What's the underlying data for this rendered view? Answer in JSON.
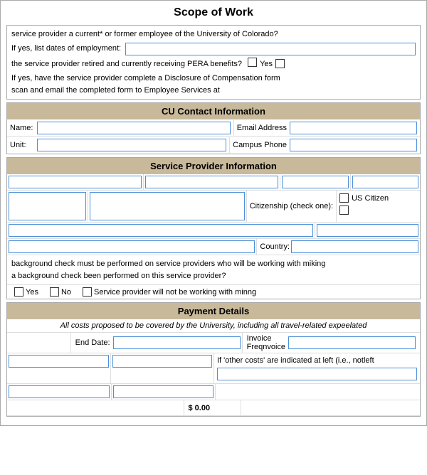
{
  "title": "Scope of Work",
  "intro": {
    "line1": "service provider a current* or former employee of the University of Colorado?",
    "employment_label": "If yes, list dates of employment:",
    "pera_line": "the service provider retired and currently receiving PERA benefits?",
    "yes_label": "Yes",
    "disclosure_line1": "If yes, have the service provider complete a Disclosure of Compensation form",
    "disclosure_line2": "scan and email the completed form to Employee Services at"
  },
  "cu_contact": {
    "header": "CU Contact Information",
    "name_label": "Name:",
    "unit_label": "Unit:",
    "email_label": "Email Address",
    "phone_label": "Campus Phone"
  },
  "service_provider": {
    "header": "Service Provider Information",
    "citizenship_label": "Citizenship (check one):",
    "us_citizen_label": "US Citizen",
    "country_label": "Country:",
    "note_line1": "background check must be performed on service providers who will be working with miking",
    "note_line2": "a background check been performed on this service provider?",
    "yes_label": "Yes",
    "no_label": "No",
    "not_working_label": "Service provider will not be working with minng"
  },
  "payment": {
    "header": "Payment Details",
    "subtitle": "All costs proposed to be covered by the University, including all travel-related expeelated",
    "end_date_label": "End Date:",
    "invoice_label": "Invoice Freqnvoice",
    "other_costs_note": "If 'other costs' are indicated at left (i.e., notleft",
    "total_amount": "$ 0.00"
  }
}
